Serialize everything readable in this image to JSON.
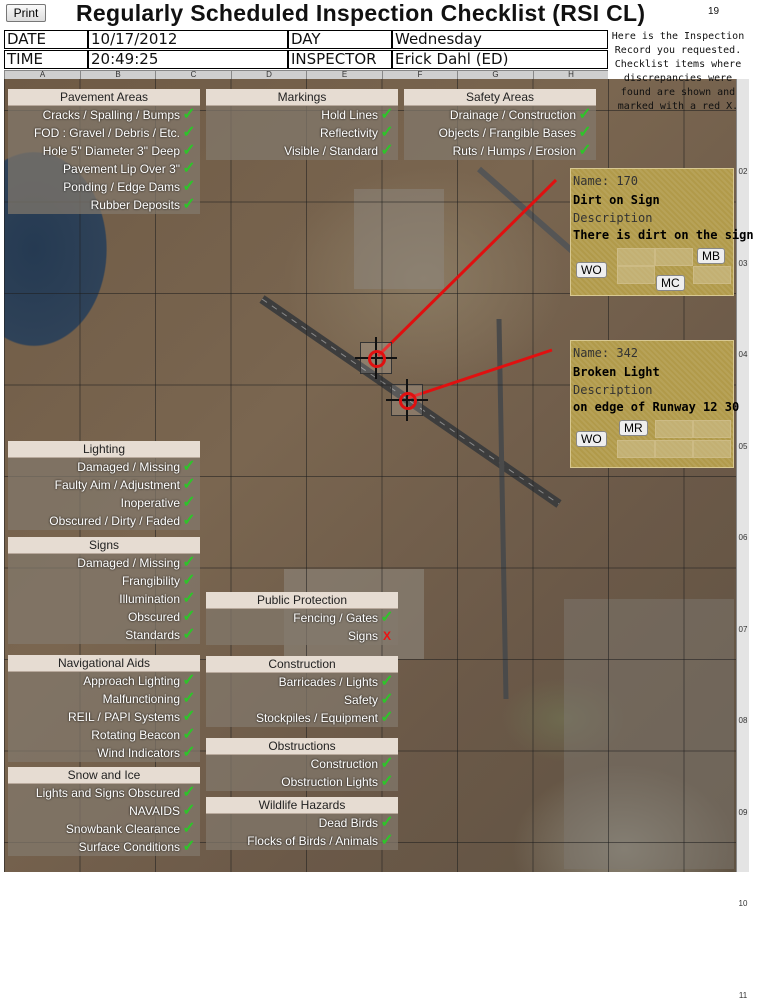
{
  "header": {
    "print_label": "Print",
    "title": "Regularly Scheduled Inspection Checklist (RSI CL)",
    "page_number": "19",
    "date_label": "DATE",
    "date_value": "10/17/2012",
    "day_label": "DAY",
    "day_value": "Wednesday",
    "time_label": "TIME",
    "time_value": "20:49:25",
    "inspector_label": "INSPECTOR",
    "inspector_value": "Erick Dahl (ED)",
    "note": "Here is the Inspection Record you requested. Checklist items where discrepancies were found are shown and marked with a red X."
  },
  "grid": {
    "columns": [
      "A",
      "B",
      "C",
      "D",
      "E",
      "F",
      "G",
      "H"
    ],
    "rows": [
      "02",
      "03",
      "04",
      "05",
      "06",
      "07",
      "08",
      "09",
      "10",
      "11"
    ]
  },
  "panels": {
    "pavement": {
      "title": "Pavement Areas",
      "items": [
        {
          "label": "Cracks / Spalling / Bumps",
          "ok": true
        },
        {
          "label": "FOD : Gravel / Debris / Etc.",
          "ok": true
        },
        {
          "label": "Hole 5\" Diameter 3\" Deep",
          "ok": true
        },
        {
          "label": "Pavement Lip Over 3\"",
          "ok": true
        },
        {
          "label": "Ponding / Edge Dams",
          "ok": true
        },
        {
          "label": "Rubber Deposits",
          "ok": true
        }
      ]
    },
    "markings": {
      "title": "Markings",
      "items": [
        {
          "label": "Hold Lines",
          "ok": true
        },
        {
          "label": "Reflectivity",
          "ok": true
        },
        {
          "label": "Visible / Standard",
          "ok": true
        }
      ]
    },
    "safety": {
      "title": "Safety Areas",
      "items": [
        {
          "label": "Drainage / Construction",
          "ok": true
        },
        {
          "label": "Objects / Frangible Bases",
          "ok": true
        },
        {
          "label": "Ruts / Humps / Erosion",
          "ok": true
        }
      ]
    },
    "lighting": {
      "title": "Lighting",
      "items": [
        {
          "label": "Damaged / Missing",
          "ok": true
        },
        {
          "label": "Faulty Aim / Adjustment",
          "ok": true
        },
        {
          "label": "Inoperative",
          "ok": true
        },
        {
          "label": "Obscured / Dirty / Faded",
          "ok": true
        }
      ]
    },
    "signs": {
      "title": "Signs",
      "items": [
        {
          "label": "Damaged / Missing",
          "ok": true
        },
        {
          "label": "Frangibility",
          "ok": true
        },
        {
          "label": "Illumination",
          "ok": true
        },
        {
          "label": "Obscured",
          "ok": true
        },
        {
          "label": "Standards",
          "ok": true
        }
      ]
    },
    "public": {
      "title": "Public Protection",
      "items": [
        {
          "label": "Fencing / Gates",
          "ok": true
        },
        {
          "label": "Signs",
          "ok": false
        }
      ]
    },
    "navaids": {
      "title": "Navigational Aids",
      "items": [
        {
          "label": "Approach Lighting",
          "ok": true
        },
        {
          "label": "Malfunctioning",
          "ok": true
        },
        {
          "label": "REIL / PAPI Systems",
          "ok": true
        },
        {
          "label": "Rotating Beacon",
          "ok": true
        },
        {
          "label": "Wind Indicators",
          "ok": true
        }
      ]
    },
    "construction": {
      "title": "Construction",
      "items": [
        {
          "label": "Barricades / Lights",
          "ok": true
        },
        {
          "label": "Safety",
          "ok": true
        },
        {
          "label": "Stockpiles / Equipment",
          "ok": true
        }
      ]
    },
    "obstructions": {
      "title": "Obstructions",
      "items": [
        {
          "label": "Construction",
          "ok": true
        },
        {
          "label": "Obstruction Lights",
          "ok": true
        }
      ]
    },
    "snow": {
      "title": "Snow and Ice",
      "items": [
        {
          "label": "Lights and Signs Obscured",
          "ok": true
        },
        {
          "label": "NAVAIDS",
          "ok": true
        },
        {
          "label": "Snowbank Clearance",
          "ok": true
        },
        {
          "label": "Surface Conditions",
          "ok": true
        }
      ]
    },
    "wildlife": {
      "title": "Wildlife Hazards",
      "items": [
        {
          "label": "Dead Birds",
          "ok": true
        },
        {
          "label": "Flocks of Birds / Animals",
          "ok": true
        }
      ]
    }
  },
  "discrepancies": [
    {
      "name_label": "Name:",
      "name_value": "170",
      "title": "Dirt on Sign",
      "desc_label": "Description",
      "desc_value": "There is dirt on the sign",
      "buttons": [
        "WO",
        "MB",
        "MC"
      ]
    },
    {
      "name_label": "Name:",
      "name_value": "342",
      "title": "Broken Light",
      "desc_label": "Description",
      "desc_value": "on edge of Runway 12 30",
      "buttons": [
        "WO",
        "MR"
      ]
    }
  ],
  "symbols": {
    "check": "✓",
    "fail": "X"
  },
  "colors": {
    "check": "#2ec42a",
    "fail": "#e11111",
    "callout_bg": "#b19a4a",
    "leader_line": "#e01010"
  }
}
